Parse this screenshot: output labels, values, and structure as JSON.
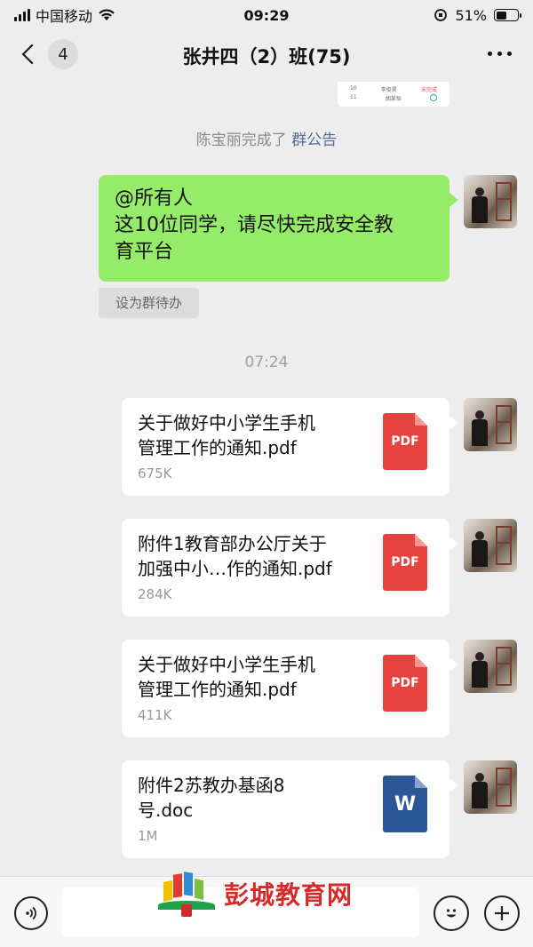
{
  "status_bar": {
    "carrier": "中国移动",
    "time": "09:29",
    "battery": "51%",
    "battery_level": 0.51
  },
  "nav": {
    "back_count": "4",
    "title": "张井四（2）班(75)"
  },
  "prev_image": {
    "row1": [
      "10",
      "李俊昊",
      "未完成"
    ],
    "row2": [
      "11",
      "胡某怡"
    ]
  },
  "system": {
    "completed_text": "陈宝丽完成了",
    "completed_link": "群公告"
  },
  "announcement": {
    "line1": "@所有人",
    "line2": "这10位同学，请尽快完成安全教",
    "line3": "育平台",
    "todo_button": "设为群待办"
  },
  "time_label": "07:24",
  "files": [
    {
      "name_line1": "关于做好中小学生手机",
      "name_line2": "管理工作的通知.pdf",
      "size": "675K",
      "type_label": "PDF"
    },
    {
      "name_line1": "附件1教育部办公厅关于",
      "name_line2": "加强中小…作的通知.pdf",
      "size": "284K",
      "type_label": "PDF"
    },
    {
      "name_line1": "关于做好中小学生手机",
      "name_line2": "管理工作的通知.pdf",
      "size": "411K",
      "type_label": "PDF"
    },
    {
      "name_line1": "附件2苏教办基函8",
      "name_line2": "号.doc",
      "size": "1M",
      "type_label": "W"
    }
  ],
  "watermark": {
    "text": "彭城教育网"
  },
  "colors": {
    "bubble_green": "#95ec69",
    "pdf_red": "#e5433d",
    "doc_blue": "#2b5797",
    "link_blue": "#576b95"
  }
}
